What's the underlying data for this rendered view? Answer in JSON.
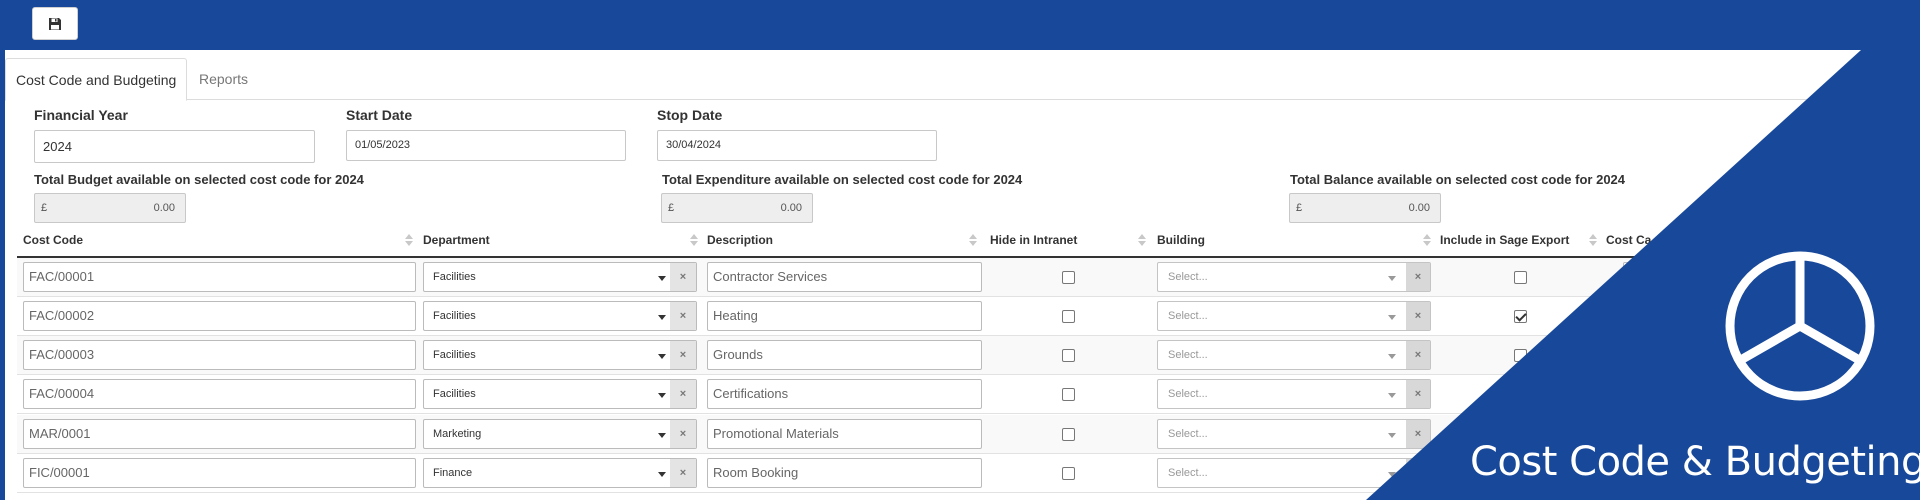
{
  "toolbar": {
    "save_icon": "floppy-disk-icon"
  },
  "tabs": [
    {
      "label": "Cost Code and Budgeting"
    },
    {
      "label": "Reports"
    }
  ],
  "filters": {
    "financial_year": {
      "label": "Financial Year",
      "value": "2024"
    },
    "start_date": {
      "label": "Start Date",
      "value": "01/05/2023"
    },
    "stop_date": {
      "label": "Stop Date",
      "value": "30/04/2024"
    }
  },
  "totals": {
    "budget": {
      "label": "Total Budget available on selected cost code for 2024",
      "currency": "£",
      "amount": "0.00"
    },
    "expenditure": {
      "label": "Total Expenditure available on selected cost code for 2024",
      "currency": "£",
      "amount": "0.00"
    },
    "balance": {
      "label": "Total Balance available on selected cost code for 2024",
      "currency": "£",
      "amount": "0.00"
    }
  },
  "table": {
    "headers": {
      "cost_code": "Cost Code",
      "department": "Department",
      "description": "Description",
      "hide_in_intranet": "Hide in Intranet",
      "building": "Building",
      "include_in_sage_export": "Include in Sage Export",
      "cost_category": "Cost Ca"
    },
    "building_placeholder": "Select...",
    "clear_glyph": "×",
    "rows": [
      {
        "cost_code": "FAC/00001",
        "department": "Facilities",
        "description": "Contractor Services",
        "hide": false,
        "sage": false
      },
      {
        "cost_code": "FAC/00002",
        "department": "Facilities",
        "description": "Heating",
        "hide": false,
        "sage": true
      },
      {
        "cost_code": "FAC/00003",
        "department": "Facilities",
        "description": "Grounds",
        "hide": false,
        "sage": false
      },
      {
        "cost_code": "FAC/00004",
        "department": "Facilities",
        "description": "Certifications",
        "hide": false,
        "sage": null
      },
      {
        "cost_code": "MAR/0001",
        "department": "Marketing",
        "description": "Promotional Materials",
        "hide": false,
        "sage": null
      },
      {
        "cost_code": "FIC/00001",
        "department": "Finance",
        "description": "Room Booking",
        "hide": false,
        "sage": null
      }
    ]
  },
  "banner": {
    "title": "Cost Code & Budgeting",
    "icon": "pie-chart-icon",
    "color": "#17489a"
  }
}
